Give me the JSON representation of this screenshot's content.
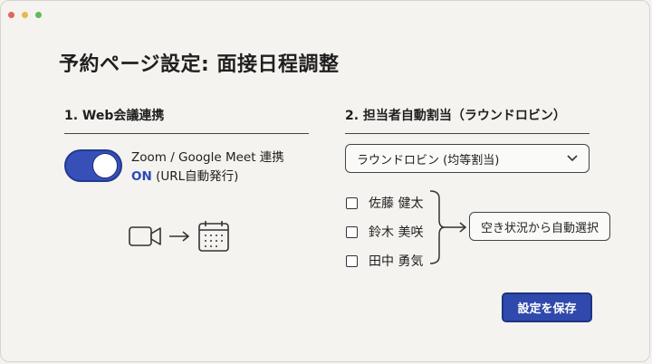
{
  "page": {
    "title": "予約ページ設定: 面接日程調整"
  },
  "web_integration": {
    "heading": "1. Web会議連携",
    "toggle_state": "on",
    "integration_label": "Zoom / Google Meet 連携",
    "status_on": "ON",
    "status_detail": " (URL自動発行)",
    "flow_icons": [
      "video-camera-icon",
      "arrow-right-icon",
      "calendar-icon"
    ]
  },
  "assignment": {
    "heading": "2. 担当者自動割当（ラウンドロビン）",
    "method_select": {
      "value": "ラウンドロビン (均等割当)"
    },
    "members": [
      {
        "name": "佐藤 健太",
        "checked": false
      },
      {
        "name": "鈴木 美咲",
        "checked": false
      },
      {
        "name": "田中 勇気",
        "checked": false
      }
    ],
    "result_label": "空き状況から自動選択"
  },
  "actions": {
    "save_label": "設定を保存"
  },
  "colors": {
    "accent": "#3650b8",
    "background": "#f3f2ee"
  }
}
